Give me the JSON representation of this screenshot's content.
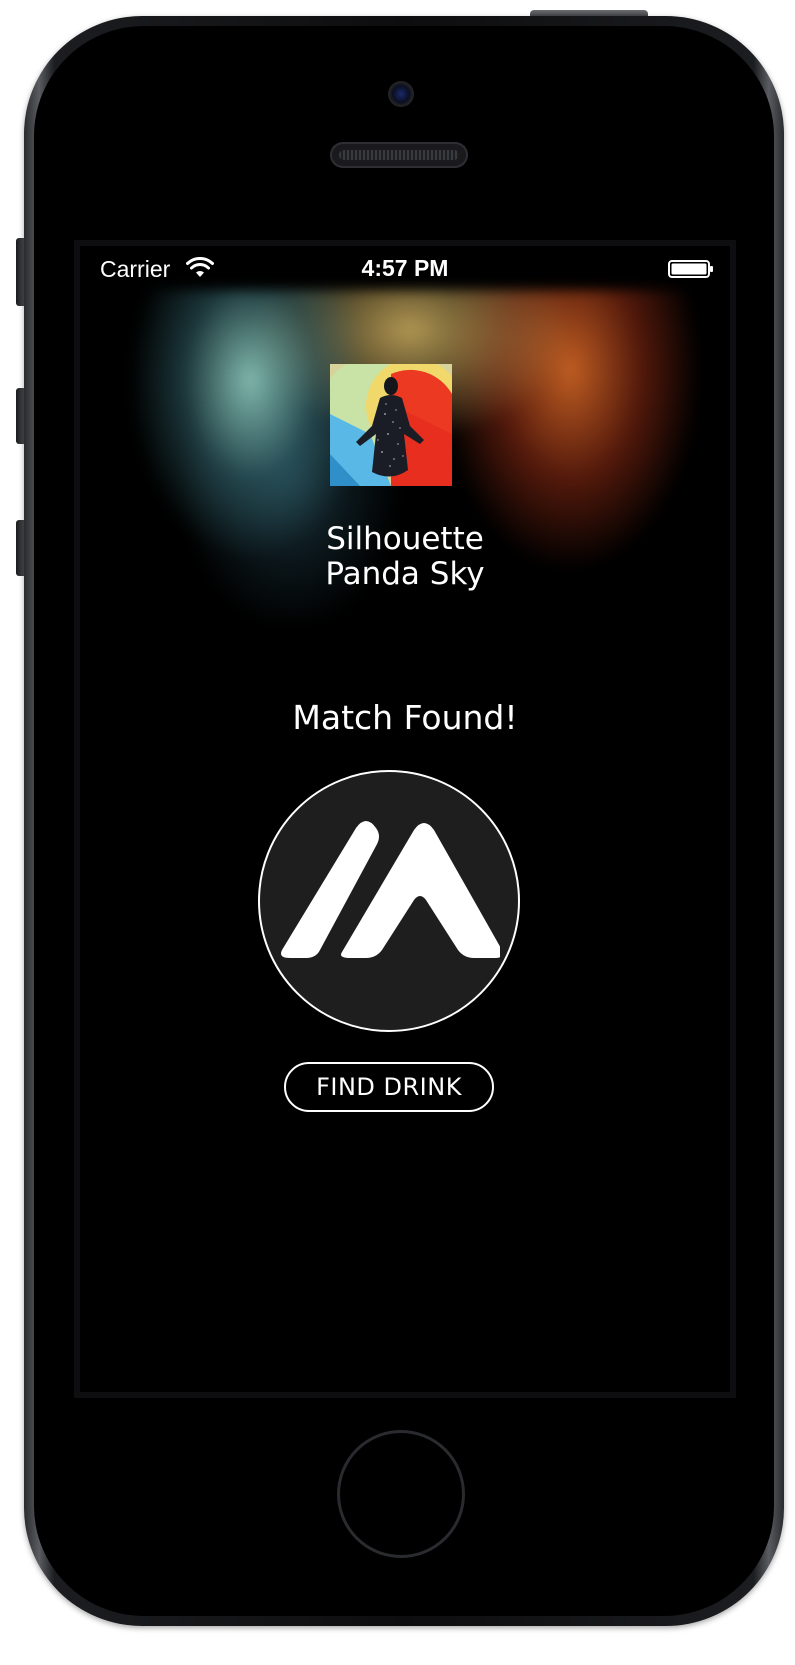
{
  "status_bar": {
    "carrier": "Carrier",
    "time": "4:57 PM"
  },
  "now_playing": {
    "title_line1": "Silhouette",
    "title_line2": "Panda Sky"
  },
  "match": {
    "label": "Match Found!",
    "button_label": "FIND DRINK"
  },
  "icons": {
    "wifi": "wifi-icon",
    "battery": "battery-icon",
    "logo": "m-logo-icon"
  },
  "colors": {
    "screen_background": "#000000",
    "text": "#ffffff",
    "logo_circle_fill": "#1e1e1e",
    "button_border": "#ffffff"
  }
}
